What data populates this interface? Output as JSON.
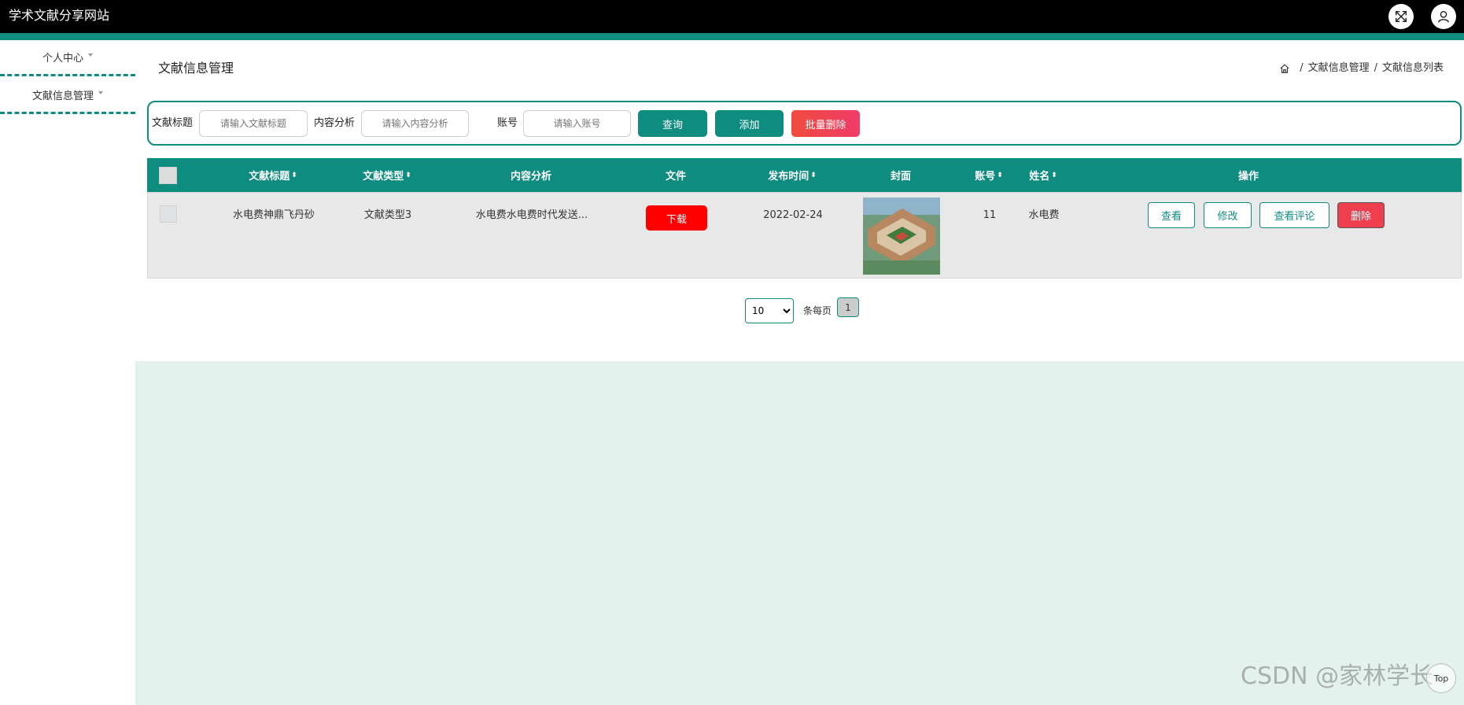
{
  "app": {
    "title": "学术文献分享网站"
  },
  "colors": {
    "accent": "#0e8c80",
    "danger": "#ff0000",
    "topbar": "#000000"
  },
  "icons": {
    "fullscreen": "fullscreen-icon",
    "user": "user-icon",
    "home": "home-icon"
  },
  "sidebar": {
    "items": [
      {
        "label": "个人中心"
      },
      {
        "label": "文献信息管理"
      }
    ]
  },
  "header": {
    "title": "文献信息管理",
    "breadcrumb": [
      "文献信息管理",
      "文献信息列表"
    ],
    "breadcrumb_sep": "/"
  },
  "search": {
    "title_label": "文献标题",
    "title_placeholder": "请输入文献标题",
    "analysis_label": "内容分析",
    "analysis_placeholder": "请输入内容分析",
    "account_label": "账号",
    "account_placeholder": "请输入账号",
    "query_button": "查询",
    "add_button": "添加",
    "batch_delete_button": "批量删除"
  },
  "table": {
    "columns": [
      "文献标题",
      "文献类型",
      "内容分析",
      "文件",
      "发布时间",
      "封面",
      "账号",
      "姓名",
      "操作"
    ],
    "sort_glyph": "⬍",
    "rows": [
      {
        "title": "水电费神鼎飞丹砂",
        "type": "文献类型3",
        "analysis": "水电费水电费时代发送...",
        "file_button": "下载",
        "date": "2022-02-24",
        "account": "11",
        "name": "水电费",
        "actions": {
          "view": "查看",
          "edit": "修改",
          "comments": "查看评论",
          "delete": "删除"
        }
      }
    ]
  },
  "pagination": {
    "page_size": "10",
    "page_size_options": [
      "10"
    ],
    "per_page_label": "条每页",
    "current_page": "1"
  },
  "watermark": "CSDN @家林学长",
  "top_button": "Top"
}
